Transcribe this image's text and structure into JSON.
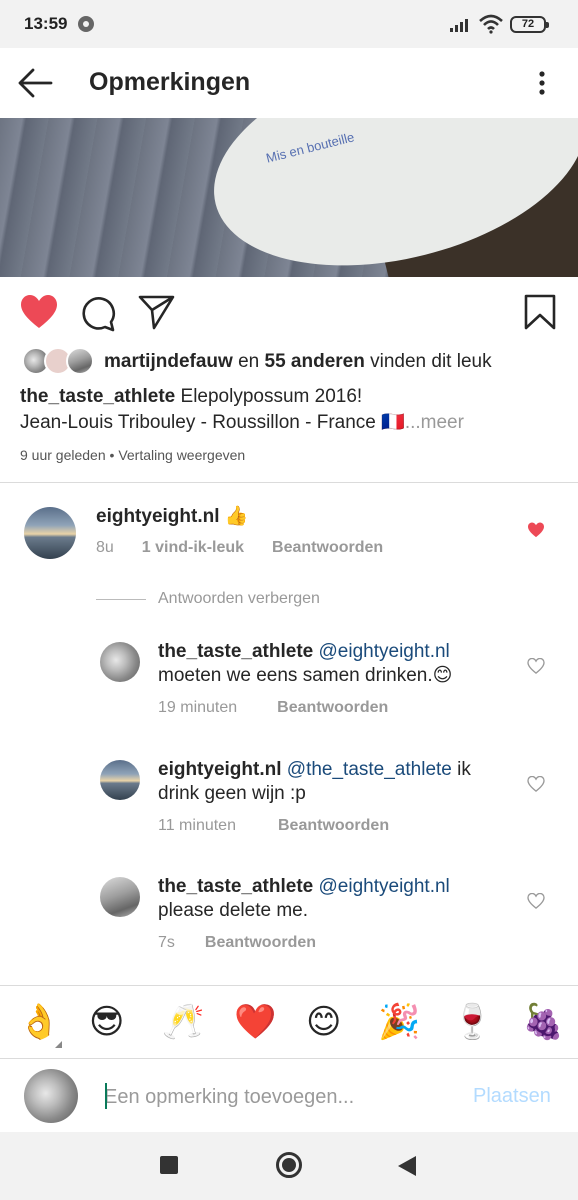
{
  "status_bar": {
    "time": "13:59",
    "battery": "72"
  },
  "app_bar": {
    "title": "Opmerkingen"
  },
  "post": {
    "bottle_text": "Mis en bouteille",
    "liked_by_user": "martijndefauw",
    "likes_connector": "en",
    "likes_others": "55 anderen",
    "likes_suffix": "vinden dit leuk",
    "caption_user": "the_taste_athlete",
    "caption_line1": "Elepolypossum 2016!",
    "caption_line2": "Jean-Louis Tribouley - Roussillon - France 🇫🇷",
    "caption_more": "...meer",
    "time_ago": "9 uur geleden",
    "translate_label": "Vertaling weergeven"
  },
  "comments": [
    {
      "user": "eightyeight.nl",
      "text": "👍",
      "time": "8u",
      "likes": "1 vind-ik-leuk",
      "reply_label": "Beantwoorden",
      "liked": true
    }
  ],
  "hide_replies_label": "Antwoorden verbergen",
  "replies": [
    {
      "user": "the_taste_athlete",
      "mention": "@eightyeight.nl",
      "text": "moeten we eens samen drinken.😊",
      "time": "19 minuten",
      "reply_label": "Beantwoorden"
    },
    {
      "user": "eightyeight.nl",
      "mention": "@the_taste_athlete",
      "text_tail": "ik",
      "text": "drink geen wijn :p",
      "time": "11 minuten",
      "reply_label": "Beantwoorden"
    },
    {
      "user": "the_taste_athlete",
      "mention": "@eightyeight.nl",
      "text": "please delete me.",
      "time": "7s",
      "reply_label": "Beantwoorden"
    }
  ],
  "emoji_bar": [
    "👌",
    "😎",
    "🥂",
    "❤️",
    "😊",
    "🎉",
    "🍷",
    "🍇"
  ],
  "composer": {
    "placeholder": "Een opmerking toevoegen...",
    "post_label": "Plaatsen"
  },
  "colors": {
    "like_red": "#ed4956",
    "mention_blue": "#1a4a7a",
    "post_button_disabled": "#b3dbff"
  }
}
